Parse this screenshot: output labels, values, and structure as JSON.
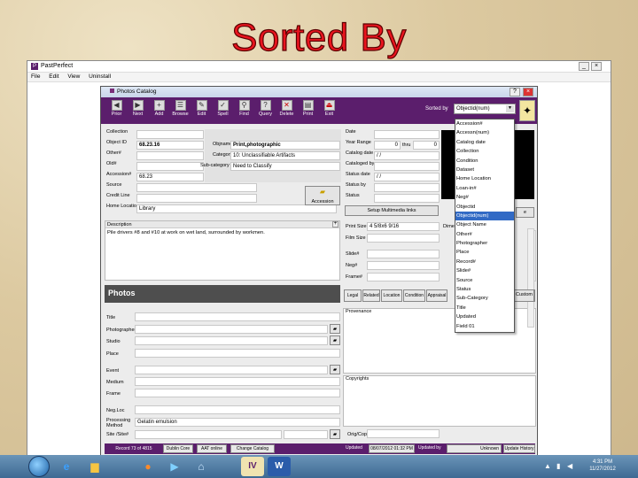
{
  "slide_title": "Sorted By",
  "app": {
    "title": "PastPerfect",
    "menu": [
      "File",
      "Edit",
      "View",
      "Uninstall"
    ]
  },
  "catalog": {
    "title": "Photos Catalog",
    "toolbar": [
      "Prior",
      "Next",
      "Add",
      "Browse",
      "Edit",
      "Spell",
      "Find",
      "Query",
      "Delete",
      "Print",
      "Exit"
    ],
    "sorted_by_label": "Sorted by",
    "sorted_by_value": "Objectid(num)",
    "left_fields": {
      "collection_label": "Collection",
      "object_id_label": "Object ID",
      "object_id_value": "68.23.16",
      "other_label": "Other#",
      "old_label": "Old#",
      "accession_label": "Accession#",
      "accession_value": "68.23",
      "source_label": "Source",
      "credit_label": "Credit Line",
      "home_location_label": "Home Location",
      "home_location_value": "Library"
    },
    "mid_fields": {
      "objname_label": "Objname",
      "objname_value": "Print,photographic",
      "category_label": "Category",
      "category_value": "10: Unclassifiable Artifacts",
      "subcategory_label": "Sub-category",
      "subcategory_value": "Need to Classify",
      "accession_btn": "Accession"
    },
    "right_fields": {
      "date_label": "Date",
      "year_range_label": "Year Range",
      "year_from": "0",
      "thru_label": "thru",
      "year_to": "0",
      "catalog_date_label": "Catalog date",
      "catalog_date_value": "/ /",
      "cataloged_by_label": "Cataloged by",
      "status_date_label": "Status date",
      "status_date_value": "/ /",
      "status_by_label": "Status by",
      "status_label": "Status",
      "multimedia_btn": "Setup Multimedia links"
    },
    "description_label": "Description",
    "description_value": "Pile drivers #8 and #10 at work on wet land, surrounded by workmen.",
    "print_fields": {
      "print_size_label": "Print Size",
      "print_size_value": "4 5/8x6 9/16",
      "film_size_label": "Film Size",
      "slide_label": "Slide#",
      "neg_label": "Neg#",
      "frame_label": "Frame#",
      "dime_label": "Dime"
    },
    "photos_header": "Photos",
    "tabs": [
      "Legal",
      "Related",
      "Location",
      "Condition",
      "Appraisal",
      "Custom"
    ],
    "photos_fields": {
      "title_label": "Title",
      "photographer_label": "Photographer",
      "studio_label": "Studio",
      "place_label": "Place",
      "event_label": "Event",
      "medium_label": "Medium",
      "frame_label": "Frame",
      "negloc_label": "Neg.Loc",
      "processing_label": "Processing Method",
      "processing_value": "Gelatin emulsion",
      "site_label": "Site /Site#",
      "provenance_label": "Provenance",
      "copyrights_label": "Copyrights",
      "orig_copy_label": "Orig/Copy"
    },
    "status_bar": {
      "record": "Record 73 of 4815",
      "dublin": "Dublin Core",
      "aat": "AAT online",
      "change": "Change Catalog",
      "updated_label": "Updated",
      "updated_value": "08/07/2012 01:32 PM",
      "updated_by_label": "Updated by",
      "updated_by_value": "Unknown",
      "history": "Update History"
    },
    "browse_btn": "e"
  },
  "sort_options": [
    "Accession#",
    "Accessn(num)",
    "Catalog date",
    "Collection",
    "Condition",
    "Dataset",
    "Home Location",
    "Loan-in#",
    "Neg#",
    "Objectid",
    "Objectid(num)",
    "Object Name",
    "Other#",
    "Photographer",
    "Place",
    "Record#",
    "Slide#",
    "Source",
    "Status",
    "Sub-Category",
    "Title",
    "Updated",
    "Field 01"
  ],
  "sort_selected_index": 10,
  "taskbar": {
    "time": "4:31 PM",
    "date": "11/27/2012",
    "icons": [
      "ie-icon",
      "explorer-icon",
      "firefox-icon",
      "media-icon",
      "network-icon",
      "pastperfect-icon",
      "word-icon"
    ]
  }
}
